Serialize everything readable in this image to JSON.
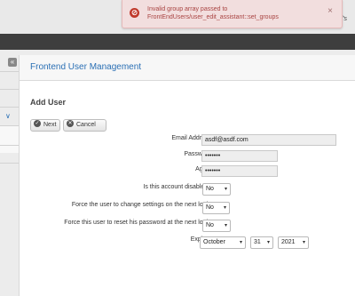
{
  "header": {
    "partial_text": "rd's"
  },
  "alert": {
    "message": "Invalid group array passed to FrontEndUsers/user_edit_assistant::set_groups",
    "icon": "error-circle-icon",
    "close": "×"
  },
  "sidebar": {
    "collapse_glyph": "«",
    "chevron": "∨"
  },
  "panel": {
    "title": "Frontend User Management"
  },
  "form": {
    "section_title": "Add User",
    "next_label": "Next",
    "cancel_label": "Cancel",
    "email_label": "Email Address:",
    "email_value": "asdf@asdf.com",
    "password_label": "Password:",
    "password_value": "•••••••",
    "again_label": "Again:",
    "again_value": "•••••••",
    "disabled_label": "Is this account disabled?:",
    "disabled_value": "No",
    "force_settings_label": "Force the user to change settings on the next login:",
    "force_settings_value": "No",
    "force_reset_label": "Force this user to reset his password at the next login:",
    "force_reset_value": "No",
    "expires_label": "Expires:",
    "expires_month": "October",
    "expires_day": "31",
    "expires_year": "2021"
  },
  "colors": {
    "accent": "#2a6fb4",
    "alert_bg": "#f2dede",
    "alert_text": "#a94442",
    "dark_bar": "#3e3e3e"
  }
}
